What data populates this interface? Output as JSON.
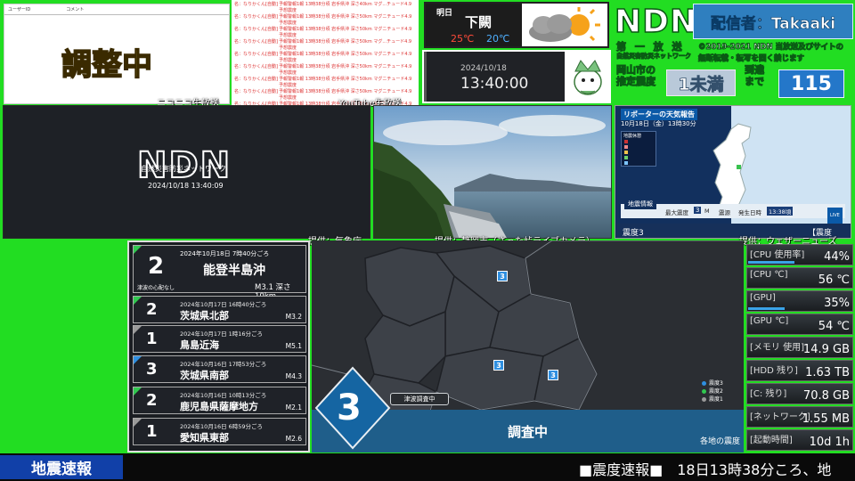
{
  "comments": {
    "header_user": "ユーザーID",
    "header_comment": "コメント",
    "status": "調整中",
    "source": "ニコニコ生放送"
  },
  "youtube": {
    "source": "YouTube生放送",
    "rows": [
      {
        "user": "名：なりかくん[自動]",
        "text": "予報警報1報 13時38分頃 岩手県沖 深さ40km マグ...チュード4.9 予想震度"
      },
      {
        "user": "名：なりかくん[自動]",
        "text": "予報警報1報 13時38分頃 岩手県沖 深さ50km マグニチュード4.9 予想震度"
      },
      {
        "user": "名：なりかくん[自動]",
        "text": "予報警報1報 13時38分頃 岩手県沖 深さ50km マグニチュード4.9 予想震度"
      },
      {
        "user": "名：なりかくん[自動]",
        "text": "予報警報1報 13時38分頃 岩手県沖 深さ50km マグ...チュード4.9 予想震度"
      },
      {
        "user": "名：なりかくん[自動]",
        "text": "予報警報1報 13時38分頃 岩手県沖 深さ50km マグニチュード4.9 予想震度"
      },
      {
        "user": "名：なりかくん[自動]",
        "text": "予報警報1報 13時38分頃 岩手県沖 深さ50km マグニチュード4.9 予想震度"
      },
      {
        "user": "名：なりかくん[自動]",
        "text": "予報警報1報 13時38分頃 岩手県沖 深さ50km マグニチュード4.9 予想震度"
      },
      {
        "user": "名：なりかくん[自動]",
        "text": "予報警報1報 13時38分頃 岩手県沖 深さ50km マグニチュード4.9 予想震度"
      },
      {
        "user": "名：なりかくん[自動]",
        "text": "予報警報1報 13時38分頃 岩手県沖 深さ50km マグニチュード4.9 予想震度"
      },
      {
        "user": "名：なりかくん[自動]",
        "text": "予報警報最終報 13時38分頃 岩手県沖 深さ50km マグニチュード4.9 予想震度"
      },
      {
        "user": "名：なりかくん[自動]",
        "text": "地震情報"
      }
    ]
  },
  "weather": {
    "label": "明日",
    "condition": "下闕",
    "high": "25℃",
    "low": "20℃"
  },
  "clock": {
    "date": "2024/10/18",
    "time": "13:40:00"
  },
  "header": {
    "logo": "NDN",
    "broadcaster": "配信者：Takaaki",
    "channel": "第 一 放 送",
    "org": "自然災害防災ネットワーク",
    "copyright": "©2019-2021 NDN 当放送及びサイトの",
    "copyright2": "無断転載・転写を固く禁じます",
    "city_label": "岡山市の推定震度",
    "city_intensity": "1未満",
    "arrival_label": "到達まで",
    "arrival_value": "115"
  },
  "ndn_video": {
    "logo": "NDN",
    "subtitle": "自然災害防災ネットワーク",
    "timestamp": "2024/10/18 13:40:09",
    "source": "提供：気象庁"
  },
  "camera": {
    "source": "提供：静岡市（さった峠ライブカメラ）"
  },
  "weathernews": {
    "title": "リポーターの天気報告",
    "datetime": "10月18日（金）13時30分",
    "legend_title": "地震休憩",
    "info_label": "地震情報",
    "max_label": "最大震度",
    "max_value": "3",
    "mag_label": "M",
    "origin_label": "震源",
    "time_label": "発生日時",
    "time_value": "13:38頃",
    "bottom_intensity": "震度3",
    "bottom_tag": "【震度",
    "brand": "LIVE",
    "source": "提供：ウェザーニューズ"
  },
  "eq_latest": {
    "intensity": "2",
    "datetime": "2024年10月18日 7時40分ごろ",
    "place": "能登半島沖",
    "tsunami": "津波の心配なし",
    "detail": "M3.1 深さ10km"
  },
  "eq_history": [
    {
      "intensity": "2",
      "datetime": "2024年10月17日 16時40分ごろ",
      "place": "茨城県北部",
      "mag": "M3.2",
      "color": "#31c850"
    },
    {
      "intensity": "1",
      "datetime": "2024年10月17日 1時16分ごろ",
      "place": "鳥島近海",
      "mag": "M5.1",
      "color": "#9a9a9a"
    },
    {
      "intensity": "3",
      "datetime": "2024年10月16日 17時53分ごろ",
      "place": "茨城県南部",
      "mag": "M4.3",
      "color": "#2f8fe0"
    },
    {
      "intensity": "2",
      "datetime": "2024年10月16日 10時13分ごろ",
      "place": "鹿児島県薩摩地方",
      "mag": "M2.1",
      "color": "#31c850"
    },
    {
      "intensity": "1",
      "datetime": "2024年10月16日 6時59分ごろ",
      "place": "愛知県東部",
      "mag": "M2.6",
      "color": "#9a9a9a"
    }
  ],
  "map": {
    "big_intensity": "3",
    "tsunami_status": "津波調査中",
    "status": "調査中",
    "caption": "各地の震度",
    "markers": [
      "3",
      "3",
      "3"
    ],
    "legend": [
      {
        "label": "震度3",
        "color": "#2f8fe0"
      },
      {
        "label": "震度2",
        "color": "#31c850"
      },
      {
        "label": "震度1",
        "color": "#9a9a9a"
      }
    ]
  },
  "stats": [
    {
      "label": "[CPU 使用率]",
      "value": "44%",
      "level": 0.44
    },
    {
      "label": "[CPU ℃]",
      "value": "56 ℃",
      "level": 0
    },
    {
      "label": "[GPU]",
      "value": "35%",
      "level": 0.35
    },
    {
      "label": "[GPU ℃]",
      "value": "54 ℃",
      "level": 0
    },
    {
      "label": "[メモリ 使用]",
      "value": "14.9 GB",
      "level": 0
    },
    {
      "label": "[HDD 残り]",
      "value": "1.63 TB",
      "level": 0
    },
    {
      "label": "[C: 残り]",
      "value": "70.8 GB",
      "level": 0
    },
    {
      "label": "[ネットワーク]",
      "value": "1.55 MB",
      "level": 0
    },
    {
      "label": "[起動時間]",
      "value": "10d 1h",
      "level": 0
    }
  ],
  "ticker": {
    "label": "地震速報",
    "text": "■震度速報■　18日13時38分ころ、地"
  }
}
